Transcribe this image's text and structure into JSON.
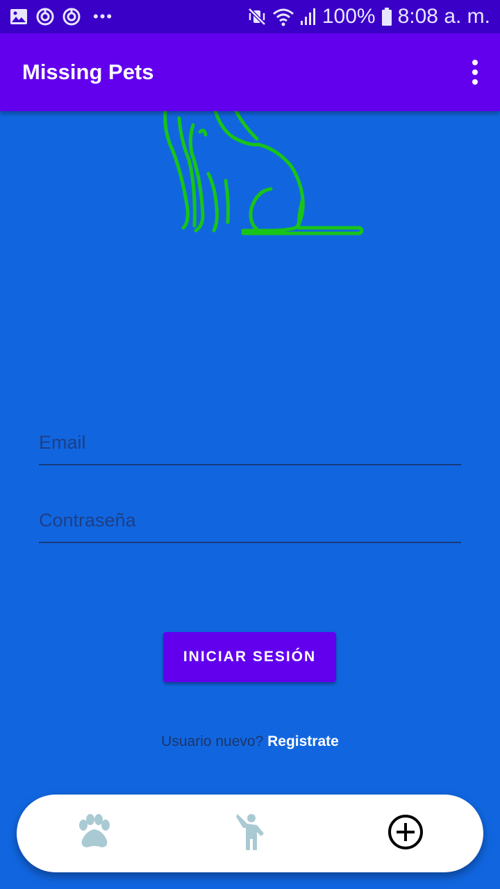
{
  "status_bar": {
    "battery": "100%",
    "time": "8:08 a. m.",
    "icons": [
      "image-icon",
      "sync-icon",
      "sync-icon",
      "more-dots-icon",
      "mute-vibrate-icon",
      "wifi-icon",
      "signal-icon",
      "battery-icon"
    ]
  },
  "app_bar": {
    "title": "Missing Pets",
    "menu_icon": "more-vert-icon"
  },
  "logo": {
    "icon": "cat-outline-icon",
    "stroke_color": "#19c419"
  },
  "form": {
    "email_placeholder": "Email",
    "email_value": "",
    "password_placeholder": "Contraseña",
    "password_value": "",
    "login_label": "INICIAR SESIÓN"
  },
  "register": {
    "prompt": "Usuario nuevo?",
    "link": "Registrate"
  },
  "bottom_nav": {
    "items": [
      {
        "icon": "paw-icon",
        "color": "#a9cad3"
      },
      {
        "icon": "person-waving-icon",
        "color": "#a9cad3"
      },
      {
        "icon": "add-circle-icon",
        "color": "#000000"
      }
    ]
  },
  "colors": {
    "background": "#1166e0",
    "status_bar": "#3a00c8",
    "primary": "#6200ee"
  }
}
